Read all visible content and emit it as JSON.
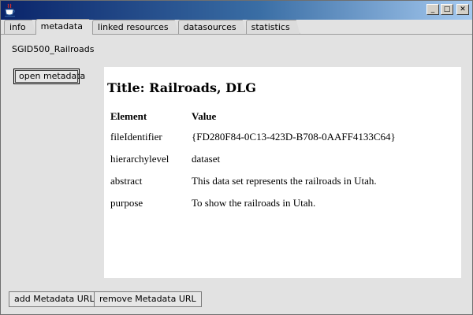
{
  "window": {
    "icon": "java-coffee-cup-icon",
    "controls": {
      "minimize": "_",
      "maximize": "□",
      "close": "✕"
    }
  },
  "tabs": [
    {
      "label": "info"
    },
    {
      "label": "metadata"
    },
    {
      "label": "linked resources"
    },
    {
      "label": "datasources"
    },
    {
      "label": "statistics"
    }
  ],
  "layer_name": "SGID500_Railroads",
  "buttons": {
    "open_metadata": "open metadata",
    "add_metadata_url": "add Metadata URL",
    "remove_metadata_url": "remove Metadata URL"
  },
  "metadata": {
    "title": "Title: Railroads, DLG",
    "headers": {
      "element": "Element",
      "value": "Value"
    },
    "rows": [
      {
        "element": "fileIdentifier",
        "value": "{FD280F84-0C13-423D-B708-0AAFF4133C64}"
      },
      {
        "element": "hierarchylevel",
        "value": "dataset"
      },
      {
        "element": "abstract",
        "value": "This data set represents the railroads in Utah."
      },
      {
        "element": "purpose",
        "value": "To show the railroads in Utah."
      }
    ]
  }
}
